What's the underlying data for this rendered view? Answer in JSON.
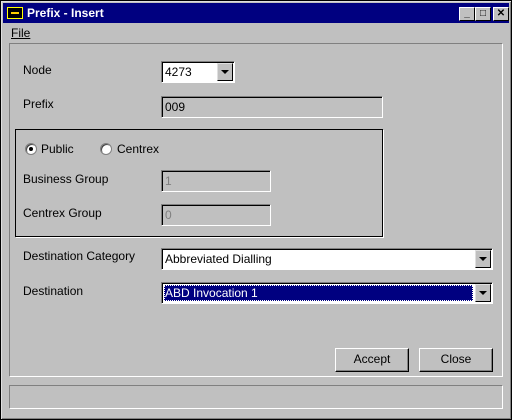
{
  "window": {
    "title": "Prefix - Insert",
    "controls": {
      "minimize": "_",
      "maximize": "□",
      "close": "✕"
    }
  },
  "menu": {
    "items": [
      {
        "label": "File"
      }
    ]
  },
  "form": {
    "node": {
      "label": "Node",
      "value": "4273"
    },
    "prefix": {
      "label": "Prefix",
      "value": "009"
    },
    "type_group": {
      "options": [
        {
          "label": "Public",
          "checked": true
        },
        {
          "label": "Centrex",
          "checked": false
        }
      ]
    },
    "business_group": {
      "label": "Business Group",
      "value": "1"
    },
    "centrex_group": {
      "label": "Centrex Group",
      "value": "0"
    },
    "destination_category": {
      "label": "Destination Category",
      "value": "Abbreviated Dialling"
    },
    "destination": {
      "label": "Destination",
      "value": "ABD Invocation 1"
    }
  },
  "buttons": {
    "accept": "Accept",
    "close": "Close"
  },
  "status": {
    "text": ""
  },
  "colors": {
    "titlebar": "#000080",
    "face": "#c0c0c0",
    "selection": "#000080"
  }
}
